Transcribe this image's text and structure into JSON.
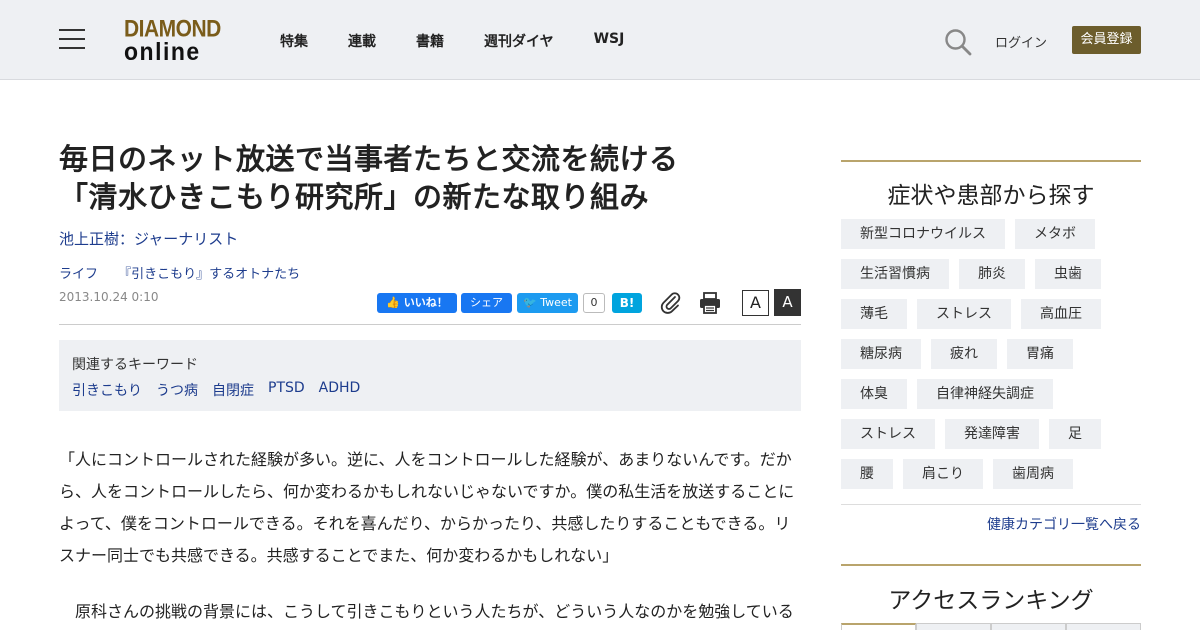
{
  "header": {
    "logo_top": "DIAMOND",
    "logo_bottom": "online",
    "nav": [
      "特集",
      "連載",
      "書籍",
      "週刊ダイヤ",
      "WSJ"
    ],
    "login": "ログイン",
    "register": "会員登録",
    "accent_color": "#6c5d2c"
  },
  "article": {
    "title_line1": "毎日のネット放送で当事者たちと交流を続ける",
    "title_line2": "「清水ひきこもり研究所」の新たな取り組み",
    "author": "池上正樹：ジャーナリスト",
    "category": "ライフ",
    "series": "『引きこもり』するオトナたち",
    "date": "2013.10.24 0:10",
    "share": {
      "like": "いいね！",
      "share": "シェア",
      "tweet": "Tweet",
      "tweet_count": "0",
      "hatena": "B!"
    },
    "font_small": "A",
    "font_large": "A",
    "keywords_label": "関連するキーワード",
    "keywords": [
      "引きこもり",
      "うつ病",
      "自閉症",
      "PTSD",
      "ADHD"
    ],
    "paragraph1": "「人にコントロールされた経験が多い。逆に、人をコントロールした経験が、あまりないんです。だから、人をコントロールしたら、何か変わるかもしれないじゃないですか。僕の私生活を放送することによって、僕をコントロールできる。それを喜んだり、からかったり、共感したりすることもできる。リスナー同士でも共感できる。共感することでまた、何か変わるかもしれない」",
    "paragraph2": "　原科さんの挑戦の背景には、こうして引きこもりという人たちが、どういう人なのかを勉強している"
  },
  "sidebar": {
    "symptoms_title": "症状や患部から探す",
    "tags": [
      [
        "新型コロナウイルス",
        "メタボ"
      ],
      [
        "生活習慣病",
        "肺炎",
        "虫歯"
      ],
      [
        "薄毛",
        "ストレス",
        "高血圧"
      ],
      [
        "糖尿病",
        "疲れ",
        "胃痛"
      ],
      [
        "体臭",
        "自律神経失調症"
      ],
      [
        "ストレス",
        "発達障害",
        "足"
      ],
      [
        "腰",
        "肩こり",
        "歯周病"
      ]
    ],
    "back_link": "健康カテゴリ一覧へ戻る",
    "ranking_title": "アクセスランキング"
  }
}
